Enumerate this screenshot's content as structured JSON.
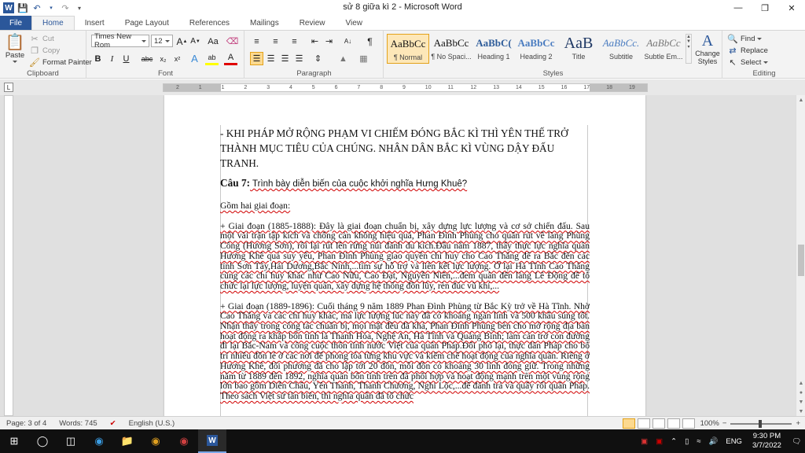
{
  "window": {
    "title": "sử 8 giữa kì 2  -  Microsoft Word",
    "app_badge": "W"
  },
  "tabs": [
    "File",
    "Home",
    "Insert",
    "Page Layout",
    "References",
    "Mailings",
    "Review",
    "View"
  ],
  "ribbon": {
    "clipboard": {
      "label": "Clipboard",
      "paste": "Paste",
      "cut": "Cut",
      "copy": "Copy",
      "format_painter": "Format Painter"
    },
    "font": {
      "label": "Font",
      "font_name": "Times New Rom",
      "font_size": "12",
      "grow": "A",
      "shrink": "A",
      "case": "Aa",
      "bold": "B",
      "italic": "I",
      "underline": "U",
      "strike": "abc",
      "subscript": "x₂",
      "superscript": "x²",
      "effects": "A",
      "highlight": "ab",
      "font_color": "A"
    },
    "paragraph": {
      "label": "Paragraph"
    },
    "styles": {
      "label": "Styles",
      "items": [
        {
          "sample": "AaBbCc",
          "name": "¶ Normal"
        },
        {
          "sample": "AaBbCc",
          "name": "¶ No Spaci..."
        },
        {
          "sample": "AaBbC(",
          "name": "Heading 1"
        },
        {
          "sample": "AaBbCc",
          "name": "Heading 2"
        },
        {
          "sample": "AaB",
          "name": "Title"
        },
        {
          "sample": "AaBbCc.",
          "name": "Subtitle"
        },
        {
          "sample": "AaBbCc",
          "name": "Subtle Em..."
        }
      ],
      "change_styles": "Change Styles"
    },
    "editing": {
      "label": "Editing",
      "find": "Find",
      "replace": "Replace",
      "select": "Select"
    }
  },
  "ruler": {
    "ticks": [
      "2",
      "1",
      "1",
      "2",
      "3",
      "4",
      "5",
      "6",
      "7",
      "8",
      "9",
      "10",
      "11",
      "12",
      "13",
      "14",
      "15",
      "16",
      "17",
      "18",
      "19"
    ]
  },
  "document": {
    "heading_caps": "- KHI PHÁP MỞ RỘNG PHẠM VI CHIẾM ĐÓNG BẮC KÌ THÌ YÊN THẾ TRỞ THÀNH MỤC TIÊU CỦA CHÚNG. NHÂN DÂN BẮC KÌ VÙNG DẬY ĐẤU TRANH.",
    "question_label": "Câu 7:",
    "question_text": " Trình bày diễn biến của cuộc khởi nghĩa Hưng Khuê?",
    "intro": "Gồm hai giai đoạn:",
    "para1": "+ Giai đoạn (1885-1888): Đây là giai đoạn chuẩn bị, xây dựng lực lượng và cơ sở chiến đấu. Sau một vài trận tập kích và chống càn không hiệu quả, Phan Đình Phùng cho quân rút về làng Phùng Công (Hương Sơn), rồi lại rút lên rừng núi đánh du kích.Đầu năm 1887, thấy thực lực nghĩa quân Hương Khê quá suy yếu, Phan Đình Phùng giao quyền chỉ huy cho Cao Thắng để ra Bắc đến các tỉnh Sơn Tây,Hải Dương,Bắc Ninh,...tìm sự hỗ trợ và liên kết lực lượng. Ở lại Hà Tĩnh Cao Thắng cùng các chỉ huy khác như Cao Nữu, Cao Đạt, Nguyễn Niên,...đem quân đến làng Lê Động để tổ chức lại lực lượng, luyện quân, xây dựng hệ thống đồn lũy, rèn đúc vũ khí,...",
    "para2": "+ Giai đoạn (1889-1896): Cuối tháng 9 năm 1889 Phan Đình Phùng từ Bắc Kỳ trở về Hà Tĩnh. Nhờ Cao Thắng và các chỉ huy khác, mà lực lượng lúc này đã có khoảng ngàn lính và 500 khẩu súng tốt. Nhận thấy trong công tác chuẩn bị, mọi mặt đều đã khá, Phan Đình Phùng bèn cho mở rộng địa bàn hoạt động ra khắp bốn tỉnh là Thanh Hóa, Nghệ An, Hà Tĩnh và Quảng Bình; làm cản trở con đường đi lại Bắc-Nam và công cuộc thôn tính nước Việt của quân Pháp.Đối phó lại, thực dân Pháp cho bố trí nhiều đồn lẻ ở các nơi để phong tỏa từng khu vực và kiểm chế hoạt động của nghĩa quân. Riêng ở Hương Khê, đối phương đã cho lập tới 20 đồn, mỗi đồn có khoảng 30 lính đóng giữ. Trong những năm từ 1889 đến 1892, nghĩa quân bốn tỉnh trên đã phối hợp và hoạt động mạnh trên một vùng rộng lớn bao gồm Diễn Châu, Yên Thành, Thanh Chương, Nghi Lộc,...để đánh trả và quấy rối quân Pháp. Theo sách Việt sử tân biên, thì nghĩa quân đã tổ chức"
  },
  "statusbar": {
    "page": "Page: 3 of 4",
    "words": "Words: 745",
    "language": "English (U.S.)",
    "zoom": "100%",
    "zoom_level_percent": 100
  },
  "taskbar": {
    "language": "ENG",
    "time": "9:30 PM",
    "date": "3/7/2022"
  },
  "colors": {
    "word_blue": "#2b579a",
    "spell_red": "#d00000",
    "grammar_green": "#2aa02a"
  }
}
